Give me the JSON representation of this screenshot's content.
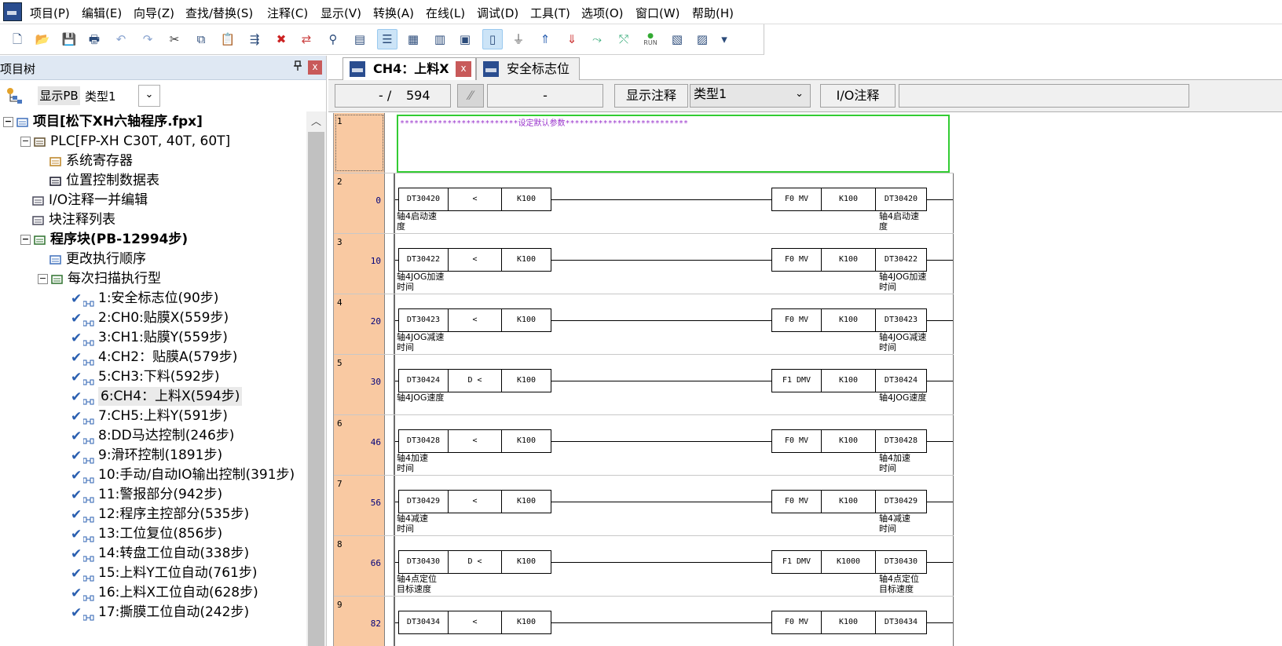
{
  "menubar": {
    "items": [
      "项目(P)",
      "编辑(E)",
      "向导(Z)",
      "查找/替换(S)",
      "注释(C)",
      "显示(V)",
      "转换(A)",
      "在线(L)",
      "调试(D)",
      "工具(T)",
      "选项(O)",
      "窗口(W)",
      "帮助(H)"
    ]
  },
  "toolbar": {
    "icons": [
      "new-file-icon",
      "open-folder-icon",
      "save-icon",
      "print-icon",
      "undo-icon",
      "redo-icon",
      "cut-icon",
      "copy-icon",
      "paste-icon",
      "insert-row-icon",
      "delete-row-icon",
      "convert-icon",
      "find-icon",
      "monitor-list-icon",
      "comment-view-icon",
      "ladder-view-icon",
      "instruction-list-icon",
      "block-view-icon",
      "plc-icon",
      "plug-icon",
      "upload-icon",
      "download-icon",
      "run-mode-icon",
      "prog-mode-icon",
      "run-icon",
      "monitor-icon",
      "register-icon",
      "more-icon"
    ],
    "run_label": "RUN"
  },
  "tree": {
    "title": "项目树",
    "pin": "ᵖ",
    "close": "x",
    "show_pb": "显示PB",
    "type_label": "类型1",
    "nodes": [
      {
        "label": "项目[松下XH六轴程序.fpx]",
        "level": 0,
        "bold": true
      },
      {
        "label": "PLC[FP-XH C30T, 40T, 60T]",
        "level": 1
      },
      {
        "label": "系统寄存器",
        "level": 2
      },
      {
        "label": "位置控制数据表",
        "level": 2
      },
      {
        "label": "I/O注释一并编辑",
        "level": 1
      },
      {
        "label": "块注释列表",
        "level": 1
      },
      {
        "label": "程序块(PB-12994步)",
        "level": 1,
        "bold": true
      },
      {
        "label": "更改执行顺序",
        "level": 2
      },
      {
        "label": "每次扫描执行型",
        "level": 2
      },
      {
        "label": "1:安全标志位(90步)",
        "level": 3
      },
      {
        "label": "2:CH0:贴膜X(559步)",
        "level": 3
      },
      {
        "label": "3:CH1:贴膜Y(559步)",
        "level": 3
      },
      {
        "label": "4:CH2：贴膜A(579步)",
        "level": 3
      },
      {
        "label": "5:CH3:下料(592步)",
        "level": 3
      },
      {
        "label": "6:CH4：上料X(594步)",
        "level": 3,
        "selected": true
      },
      {
        "label": "7:CH5:上料Y(591步)",
        "level": 3
      },
      {
        "label": "8:DD马达控制(246步)",
        "level": 3
      },
      {
        "label": "9:滑环控制(1891步)",
        "level": 3
      },
      {
        "label": "10:手动/自动IO输出控制(391步)",
        "level": 3
      },
      {
        "label": "11:警报部分(942步)",
        "level": 3
      },
      {
        "label": "12:程序主控部分(535步)",
        "level": 3
      },
      {
        "label": "13:工位复位(856步)",
        "level": 3
      },
      {
        "label": "14:转盘工位自动(338步)",
        "level": 3
      },
      {
        "label": "15:上料Y工位自动(761步)",
        "level": 3
      },
      {
        "label": "16:上料X工位自动(628步)",
        "level": 3
      },
      {
        "label": "17:撕膜工位自动(242步)",
        "level": 3
      }
    ]
  },
  "tabs": [
    {
      "label": "CH4：上料X",
      "active": true,
      "close": "x"
    },
    {
      "label": "安全标志位",
      "active": false
    }
  ],
  "editor_bar": {
    "position": "- /",
    "total_steps": "594",
    "blank": "-",
    "show_comment": "显示注释",
    "type_value": "类型1",
    "io_comment": "I/O注释",
    "io_comment_value": ""
  },
  "ladder": {
    "comment_line": "*************************设定默认参数**************************",
    "rows": [
      {
        "no": "2",
        "step": "0",
        "left": "DT30420",
        "op": "<",
        "k": "K100",
        "instr": "F0 MV",
        "src": "K100",
        "dst": "DT30420",
        "cmt_l": "轴4启动速\n度",
        "cmt_r": "轴4启动速\n度"
      },
      {
        "no": "3",
        "step": "10",
        "left": "DT30422",
        "op": "<",
        "k": "K100",
        "instr": "F0 MV",
        "src": "K100",
        "dst": "DT30422",
        "cmt_l": "轴4JOG加速\n时间",
        "cmt_r": "轴4JOG加速\n时间"
      },
      {
        "no": "4",
        "step": "20",
        "left": "DT30423",
        "op": "<",
        "k": "K100",
        "instr": "F0 MV",
        "src": "K100",
        "dst": "DT30423",
        "cmt_l": "轴4JOG减速\n时间",
        "cmt_r": "轴4JOG减速\n时间"
      },
      {
        "no": "5",
        "step": "30",
        "left": "DT30424",
        "op": "D <",
        "k": "K100",
        "instr": "F1 DMV",
        "src": "K100",
        "dst": "DT30424",
        "cmt_l": "轴4JOG速度",
        "cmt_r": "轴4JOG速度"
      },
      {
        "no": "6",
        "step": "46",
        "left": "DT30428",
        "op": "<",
        "k": "K100",
        "instr": "F0 MV",
        "src": "K100",
        "dst": "DT30428",
        "cmt_l": "轴4加速\n时间",
        "cmt_r": "轴4加速\n时间"
      },
      {
        "no": "7",
        "step": "56",
        "left": "DT30429",
        "op": "<",
        "k": "K100",
        "instr": "F0 MV",
        "src": "K100",
        "dst": "DT30429",
        "cmt_l": "轴4减速\n时间",
        "cmt_r": "轴4减速\n时间"
      },
      {
        "no": "8",
        "step": "66",
        "left": "DT30430",
        "op": "D <",
        "k": "K100",
        "instr": "F1 DMV",
        "src": "K1000",
        "dst": "DT30430",
        "cmt_l": "轴4点定位\n目标速度",
        "cmt_r": "轴4点定位\n目标速度"
      },
      {
        "no": "9",
        "step": "82",
        "left": "DT30434",
        "op": "<",
        "k": "K100",
        "instr": "F0 MV",
        "src": "K100",
        "dst": "DT30434",
        "cmt_l": "",
        "cmt_r": ""
      }
    ]
  }
}
